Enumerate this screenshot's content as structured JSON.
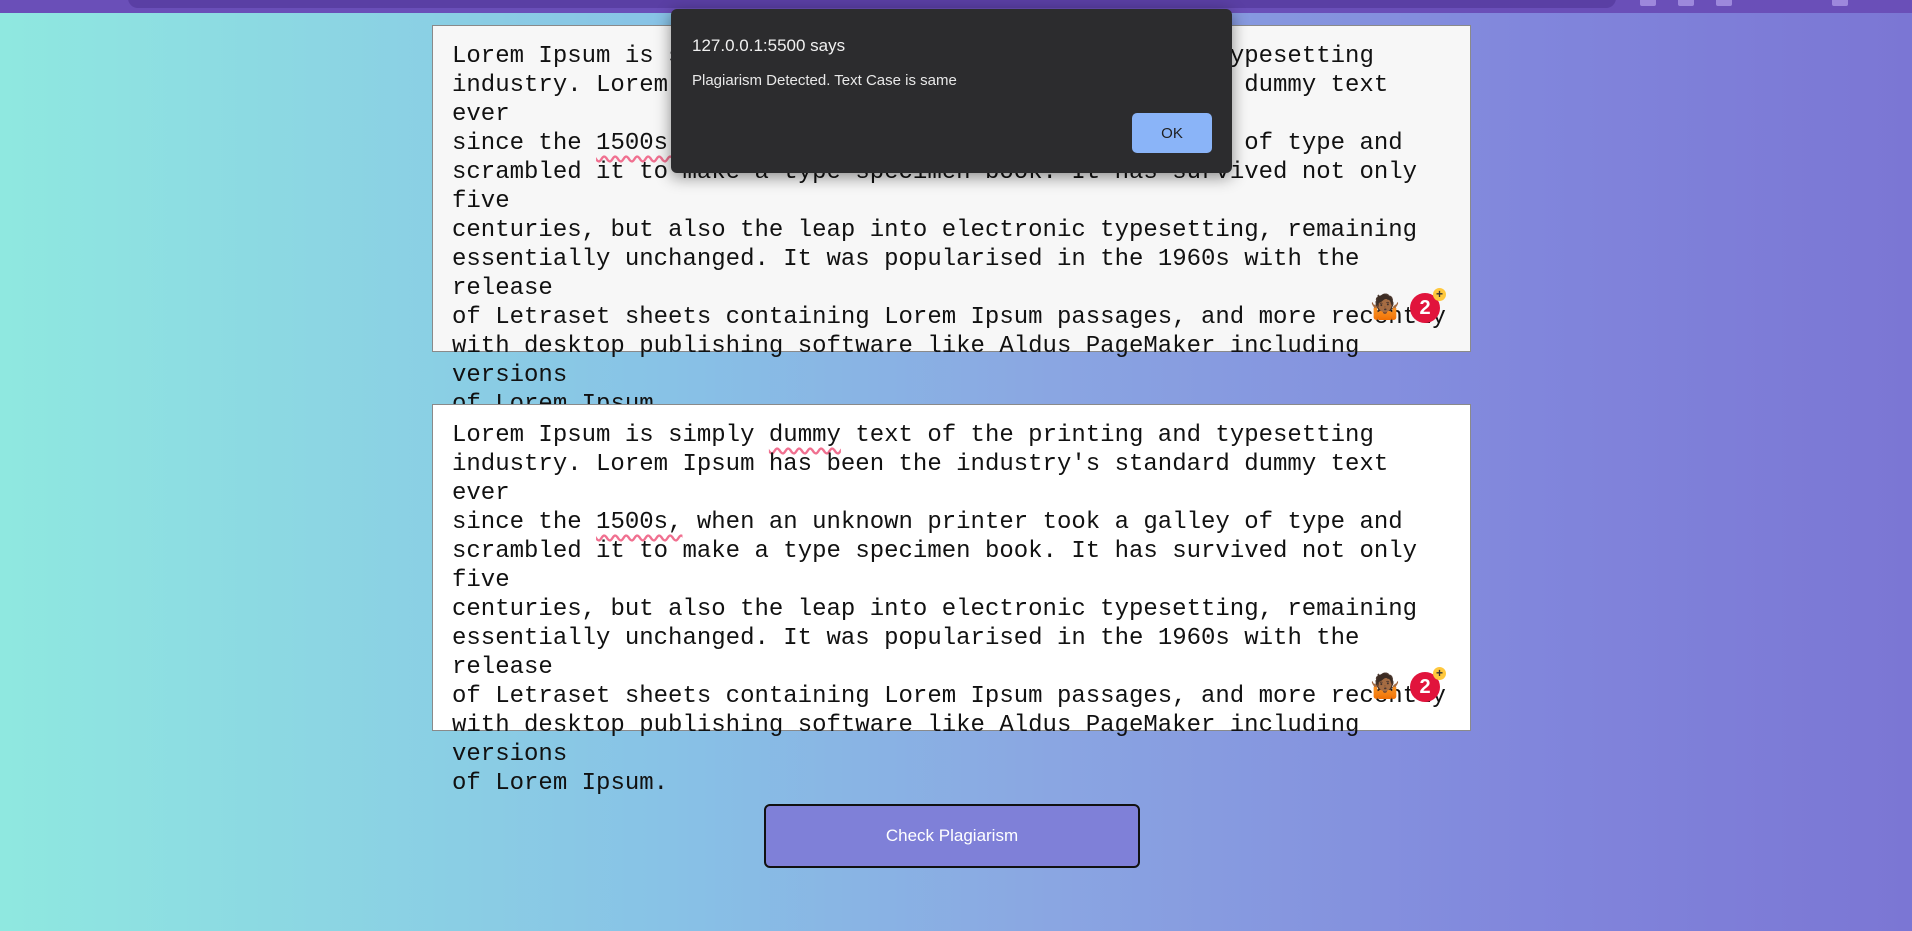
{
  "browser": {},
  "textareas": [
    {
      "lines": [
        "Lorem Ipsum is simply dummy text of the printing and typesetting",
        "industry. Lorem Ipsum has been the industry's standard dummy text ever",
        "since the 1500s, when an unknown printer took a galley of type and",
        "scrambled it to make a type specimen book. It has survived not only five",
        "centuries, but also the leap into electronic typesetting, remaining",
        "essentially unchanged. It was popularised in the 1960s with the release",
        "of Letraset sheets containing Lorem Ipsum passages, and more recently",
        "with desktop publishing software like Aldus PageMaker including versions",
        "of Lorem Ipsum."
      ],
      "background": "#f7f7f7",
      "grammarly_count": "2",
      "grammarly_plus": "+"
    },
    {
      "lines": [
        "Lorem Ipsum is simply dummy text of the printing and typesetting",
        "industry. Lorem Ipsum has been the industry's standard dummy text ever",
        "since the 1500s, when an unknown printer took a galley of type and",
        "scrambled it to make a type specimen book. It has survived not only five",
        "centuries, but also the leap into electronic typesetting, remaining",
        "essentially unchanged. It was popularised in the 1960s with the release",
        "of Letraset sheets containing Lorem Ipsum passages, and more recently",
        "with desktop publishing software like Aldus PageMaker including versions",
        "of Lorem Ipsum."
      ],
      "background": "#ffffff",
      "grammarly_count": "2",
      "grammarly_plus": "+"
    }
  ],
  "check_button": {
    "label": "Check Plagiarism",
    "color": "#7f80d8"
  },
  "alert": {
    "origin": "127.0.0.1:5500 says",
    "message": "Plagiarism Detected. Text Case is same",
    "ok_label": "OK",
    "ok_color": "#8ab4f8"
  }
}
